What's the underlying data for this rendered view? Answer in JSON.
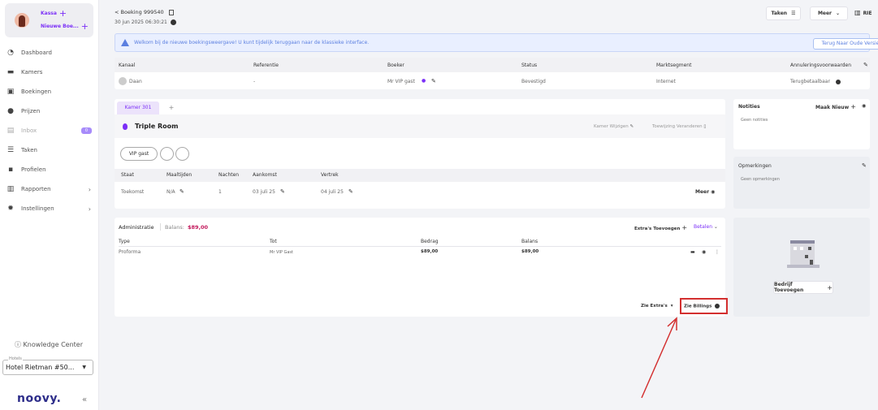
{
  "sidebar": {
    "kassa": "Kassa",
    "new_booking": "Nieuwe Boe...",
    "items": [
      {
        "label": "Dashboard",
        "icon": "dashboard-icon",
        "glyph": "◔"
      },
      {
        "label": "Kamers",
        "icon": "bed-icon",
        "glyph": "▬"
      },
      {
        "label": "Boekingen",
        "icon": "calendar-icon",
        "glyph": "▣"
      },
      {
        "label": "Prijzen",
        "icon": "price-icon",
        "glyph": "●"
      },
      {
        "label": "Inbox",
        "icon": "inbox-icon",
        "glyph": "▤",
        "badge": "0"
      },
      {
        "label": "Taken",
        "icon": "tasks-icon",
        "glyph": "☰"
      },
      {
        "label": "Profielen",
        "icon": "profile-icon",
        "glyph": "▪"
      },
      {
        "label": "Rapporten",
        "icon": "reports-icon",
        "glyph": "▥"
      },
      {
        "label": "Instellingen",
        "icon": "settings-icon",
        "glyph": "✹"
      }
    ],
    "knowledge_center": "Knowledge Center",
    "hotels_label": "Hotels",
    "hotel_value": "Hotel Rietman #50...",
    "logo": "noovy.",
    "collapse": "«"
  },
  "header": {
    "back_title": "< Boeking 999540",
    "date": "30 jun 2025 06:30:21",
    "taken": "Taken",
    "meer": "Meer",
    "user": "RIE"
  },
  "notice": {
    "text": "Welkom bij de nieuwe boekingsweergave! U kunt tijdelijk teruggaan naar de klassieke interface.",
    "button": "Terug Naar Oude Versie"
  },
  "booking_table": {
    "headers": [
      "Kanaal",
      "Referentie",
      "Boeker",
      "Status",
      "Marktsegment",
      "Annuleringsvoorwaarden"
    ],
    "kanaal": "Daan",
    "referentie": "-",
    "boeker": "Mr VIP gast",
    "status": "Bevestigd",
    "marktsegment": "Internet",
    "annulering": "Terugbetaalbaar"
  },
  "room": {
    "tab": "Kamer 301",
    "add_tab": "+",
    "type": "Triple Room",
    "wijzigen": "Kamer Wijzigen",
    "toewijzing": "Toewijzing Veranderen",
    "guest": "VIP gast",
    "headers": [
      "Staat",
      "Maaltijden",
      "Nachten",
      "Aankomst",
      "Vertrek"
    ],
    "staat": "Toekomst",
    "maaltijden": "N/A",
    "nachten": "1",
    "aankomst": "03 juli 25",
    "vertrek": "04 juli 25",
    "meer": "Meer"
  },
  "notes": {
    "title": "Notities",
    "new": "Maak Nieuw",
    "empty": "Geen notities"
  },
  "remarks": {
    "title": "Opmerkingen",
    "empty": "Geen opmerkingen"
  },
  "admin": {
    "title": "Administratie",
    "balance_label": "Balans:",
    "balance_value": "$89,00",
    "extras": "Extra's Toevoegen",
    "betalen": "Betalen",
    "headers": [
      "Type",
      "Tot",
      "Bedrag",
      "Balans"
    ],
    "rows": [
      {
        "type": "Proforma",
        "tot": "Mr VIP Gast",
        "bedrag": "$89,00",
        "balans": "$89,00"
      }
    ],
    "zie_extras": "Zie Extra's",
    "zie_billings": "Zie Billings"
  },
  "company": {
    "button": "Bedrijf Toevoegen"
  },
  "colors": {
    "accent": "#7b2ff7",
    "highlight": "#d32f2f",
    "notice_bg": "#e9efff"
  }
}
